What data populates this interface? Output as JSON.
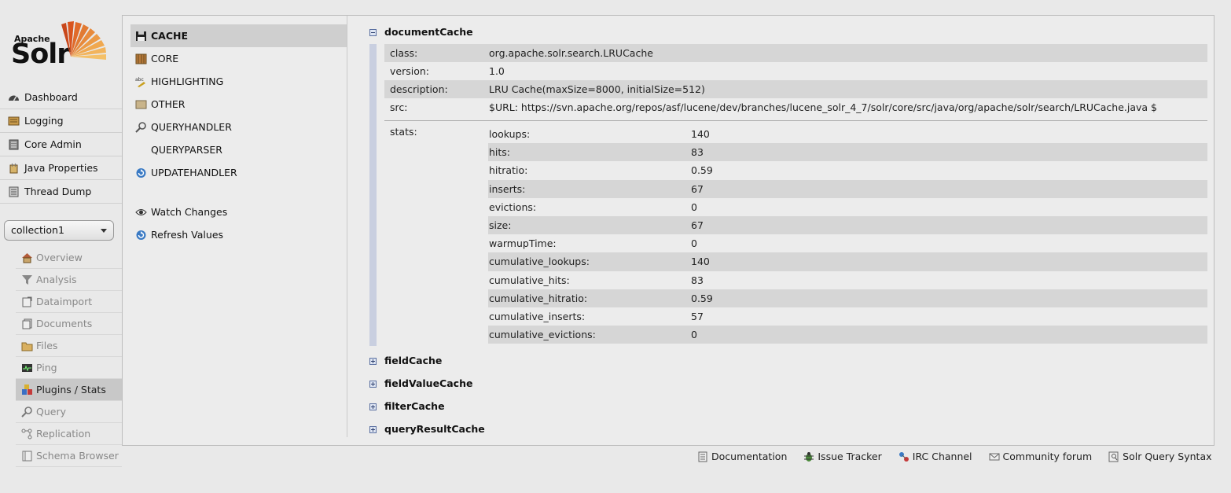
{
  "logo": {
    "apache": "Apache",
    "solr": "Solr"
  },
  "main_nav": [
    {
      "label": "Dashboard",
      "icon": "dashboard-icon"
    },
    {
      "label": "Logging",
      "icon": "logging-icon"
    },
    {
      "label": "Core Admin",
      "icon": "core-admin-icon"
    },
    {
      "label": "Java Properties",
      "icon": "java-properties-icon"
    },
    {
      "label": "Thread Dump",
      "icon": "thread-dump-icon"
    }
  ],
  "core_selector": {
    "value": "collection1"
  },
  "core_nav": [
    {
      "label": "Overview",
      "icon": "home-icon"
    },
    {
      "label": "Analysis",
      "icon": "funnel-icon"
    },
    {
      "label": "Dataimport",
      "icon": "dataimport-icon"
    },
    {
      "label": "Documents",
      "icon": "documents-icon"
    },
    {
      "label": "Files",
      "icon": "folder-icon"
    },
    {
      "label": "Ping",
      "icon": "ping-icon"
    },
    {
      "label": "Plugins / Stats",
      "icon": "plugins-icon",
      "active": true
    },
    {
      "label": "Query",
      "icon": "magnifier-icon"
    },
    {
      "label": "Replication",
      "icon": "replication-icon"
    },
    {
      "label": "Schema Browser",
      "icon": "schema-icon"
    }
  ],
  "plugin_types": [
    {
      "label": "CACHE",
      "icon": "floppy-icon",
      "active": true
    },
    {
      "label": "CORE",
      "icon": "core-icon"
    },
    {
      "label": "HIGHLIGHTING",
      "icon": "highlight-icon"
    },
    {
      "label": "OTHER",
      "icon": "other-icon"
    },
    {
      "label": "QUERYHANDLER",
      "icon": "magnifier-icon"
    },
    {
      "label": "QUERYPARSER",
      "icon": ""
    },
    {
      "label": "UPDATEHANDLER",
      "icon": "update-icon"
    }
  ],
  "actions": {
    "watch_changes": "Watch Changes",
    "refresh_values": "Refresh Values"
  },
  "open_cache": {
    "name": "documentCache",
    "class_label": "class:",
    "class_value": "org.apache.solr.search.LRUCache",
    "version_label": "version:",
    "version_value": "1.0",
    "description_label": "description:",
    "description_value": "LRU Cache(maxSize=8000, initialSize=512)",
    "src_label": "src:",
    "src_value": "$URL: https://svn.apache.org/repos/asf/lucene/dev/branches/lucene_solr_4_7/solr/core/src/java/org/apache/solr/search/LRUCache.java $",
    "stats_label": "stats:",
    "stats": [
      {
        "key": "lookups:",
        "value": "140"
      },
      {
        "key": "hits:",
        "value": "83"
      },
      {
        "key": "hitratio:",
        "value": "0.59"
      },
      {
        "key": "inserts:",
        "value": "67"
      },
      {
        "key": "evictions:",
        "value": "0"
      },
      {
        "key": "size:",
        "value": "67"
      },
      {
        "key": "warmupTime:",
        "value": "0"
      },
      {
        "key": "cumulative_lookups:",
        "value": "140"
      },
      {
        "key": "cumulative_hits:",
        "value": "83"
      },
      {
        "key": "cumulative_hitratio:",
        "value": "0.59"
      },
      {
        "key": "cumulative_inserts:",
        "value": "57"
      },
      {
        "key": "cumulative_evictions:",
        "value": "0"
      }
    ]
  },
  "other_caches": [
    "fieldCache",
    "fieldValueCache",
    "filterCache",
    "queryResultCache"
  ],
  "footer": [
    {
      "label": "Documentation",
      "icon": "document-icon"
    },
    {
      "label": "Issue Tracker",
      "icon": "bug-icon"
    },
    {
      "label": "IRC Channel",
      "icon": "irc-icon"
    },
    {
      "label": "Community forum",
      "icon": "mail-icon"
    },
    {
      "label": "Solr Query Syntax",
      "icon": "query-syntax-icon"
    }
  ],
  "colors": {
    "accent": "#d9541e",
    "active_bg": "#c8c8c8",
    "row_shade": "#d6d6d6",
    "tree_line": "#c9cfe0"
  }
}
